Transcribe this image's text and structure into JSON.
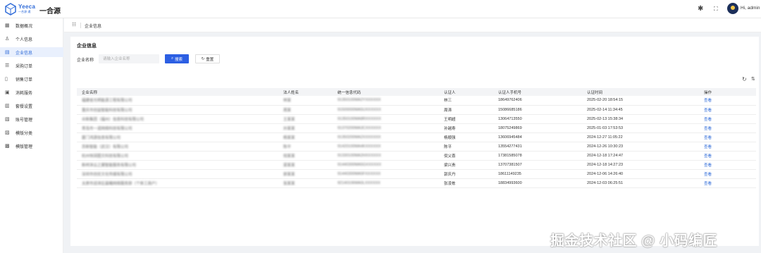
{
  "app": {
    "logo_text": "Yeeca",
    "logo_sub": "一合源·通",
    "title": "一合源",
    "user": "Hi, admin",
    "brand_color": "#2f6bd8"
  },
  "sidebar": {
    "items": [
      {
        "label": "数据概况",
        "icon": "grid-icon"
      },
      {
        "label": "个人信息",
        "icon": "user-icon"
      },
      {
        "label": "企业信息",
        "icon": "building-icon",
        "active": true
      },
      {
        "label": "采购订单",
        "icon": "order-icon"
      },
      {
        "label": "销售订单",
        "icon": "sales-icon"
      },
      {
        "label": "消耗服务",
        "icon": "service-icon"
      },
      {
        "label": "套餐设置",
        "icon": "package-icon"
      },
      {
        "label": "账号管理",
        "icon": "account-icon"
      },
      {
        "label": "模版分类",
        "icon": "category-icon"
      },
      {
        "label": "模版管理",
        "icon": "template-icon"
      }
    ]
  },
  "breadcrumb": {
    "label": "企业信息"
  },
  "page": {
    "title": "企业信息",
    "filter_label": "企业名称",
    "filter_placeholder": "请输入企业名称",
    "search_label": "搜索",
    "reset_label": "重置"
  },
  "table": {
    "columns": [
      "企业名称",
      "法人姓名",
      "统一信息代码",
      "认证人",
      "认证人手机号",
      "认证时间",
      "操作"
    ],
    "rows": [
      {
        "company": "福建省光明能源工程有限公司",
        "legal": "林某",
        "code": "91350100MA2YXXXXXX",
        "certifier": "林三",
        "phone": "18649762406",
        "time": "2025-02-20 18:54:15",
        "action": "查看"
      },
      {
        "company": "重庆市创益智能科技有限公司",
        "legal": "周某",
        "code": "91500000MA5UXXXXXX",
        "certifier": "周涛",
        "phone": "15086685186",
        "time": "2025-02-14 11:34:45",
        "action": "查看"
      },
      {
        "company": "众新集团（福州）信息科技有限公司",
        "legal": "王某某",
        "code": "91350100MA8RXXXXXX",
        "certifier": "王明超",
        "phone": "13064713550",
        "time": "2025-02-13 15:38:34",
        "action": "查看"
      },
      {
        "company": "青岛市一诺网络科技有限公司",
        "legal": "孙某某",
        "code": "91370200MA3CXXXXXX",
        "certifier": "孙越寿",
        "phone": "18075249869",
        "time": "2025-01-03 17:53:53",
        "action": "查看"
      },
      {
        "company": "厦门鸿源信息有限公司",
        "legal": "杨某某",
        "code": "91350200MA2XXXXXXX",
        "certifier": "杨顺强",
        "phone": "13606945484",
        "time": "2024-12-27 11:05:22",
        "action": "查看"
      },
      {
        "company": "苏新智能（武汉）有限公司",
        "legal": "陈平",
        "code": "91420100MA4KXXXXXX",
        "certifier": "陈平",
        "phone": "13554277431",
        "time": "2024-12-26 10:30:23",
        "action": "查看"
      },
      {
        "company": "杭州恒润图文科技有限公司",
        "legal": "倪某某",
        "code": "91330100MA2HXXXXXX",
        "certifier": "倪父喜",
        "phone": "17381585078",
        "time": "2024-12-18 17:24:47",
        "action": "查看"
      },
      {
        "company": "新柯泽云之翼智能服务有限公司",
        "legal": "梁某某",
        "code": "91440300MA5GXXXXXX",
        "certifier": "梁兴贵",
        "phone": "13707381507",
        "time": "2024-12-18 14:27:23",
        "action": "查看"
      },
      {
        "company": "深圳市创优文化传媒有限公司",
        "legal": "郭某某",
        "code": "91440300MA5FXXXXXX",
        "certifier": "郭庆丹",
        "phone": "18611149235",
        "time": "2024-12-06 14:26:40",
        "action": "查看"
      },
      {
        "company": "太原市迎泽区晨曦网络服务部（个体工商户）",
        "legal": "张某某",
        "code": "92140106MA0LXXXXXX",
        "certifier": "张凌栋",
        "phone": "18834993600",
        "time": "2024-12-03 06:25:51",
        "action": "查看"
      }
    ]
  },
  "watermark": "掘金技术社区 @ 小码编匠"
}
